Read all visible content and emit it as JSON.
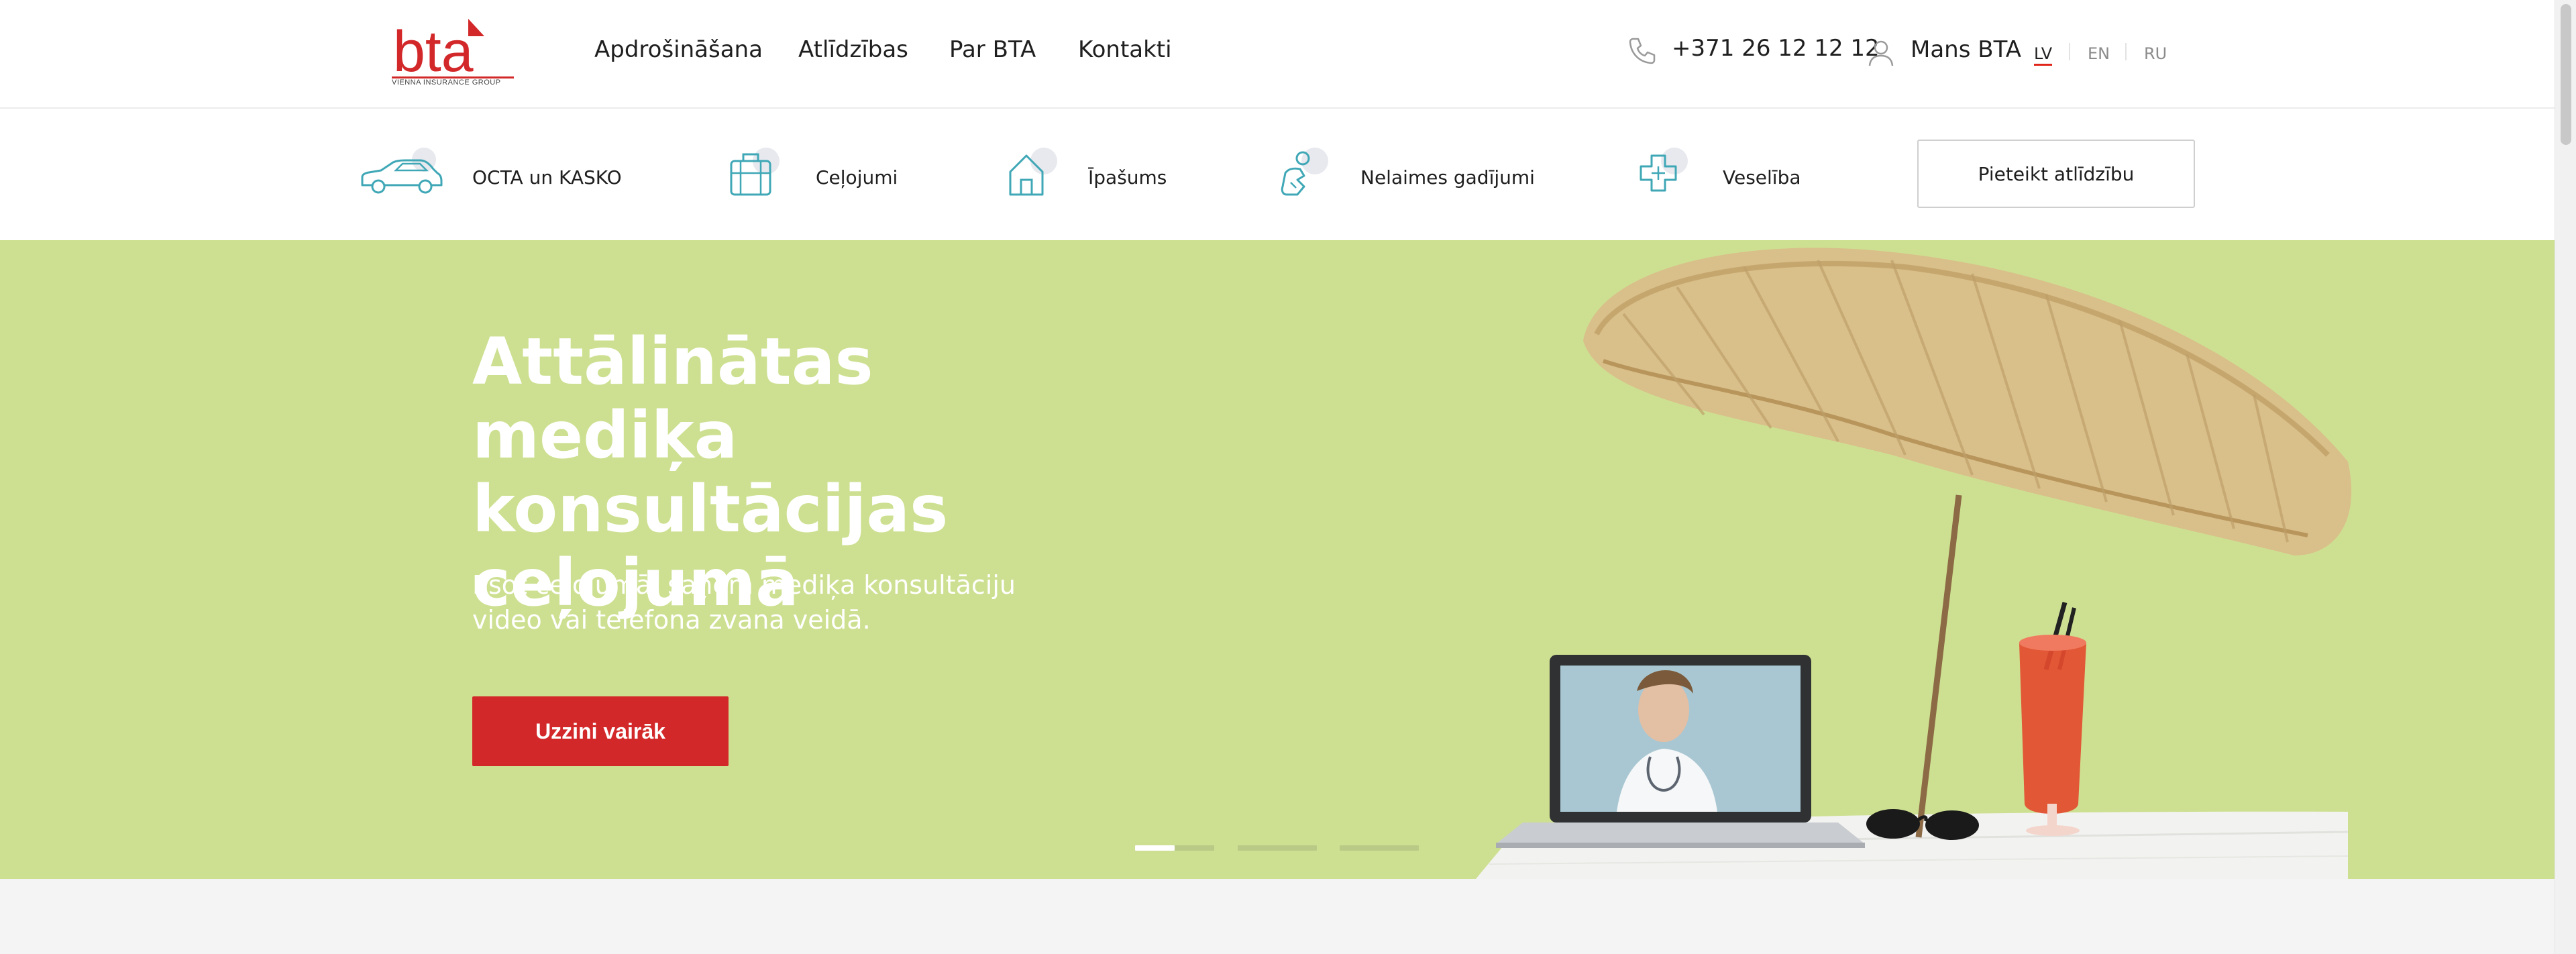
{
  "header": {
    "logo_text": "bta",
    "logo_tagline": "VIENNA INSURANCE GROUP",
    "nav": [
      {
        "label": "Apdrošināšana"
      },
      {
        "label": "Atlīdzības"
      },
      {
        "label": "Par BTA"
      },
      {
        "label": "Kontakti"
      }
    ],
    "phone": "+371 26 12 12 12",
    "account_label": "Mans BTA",
    "languages": [
      {
        "code": "LV",
        "active": true
      },
      {
        "code": "EN",
        "active": false
      },
      {
        "code": "RU",
        "active": false
      }
    ]
  },
  "categories": [
    {
      "label": "OCTA un KASKO",
      "icon": "car-icon"
    },
    {
      "label": "Ceļojumi",
      "icon": "suitcase-icon"
    },
    {
      "label": "Īpašums",
      "icon": "house-icon"
    },
    {
      "label": "Nelaimes gadījumi",
      "icon": "injury-icon"
    },
    {
      "label": "Veselība",
      "icon": "medical-cross-icon"
    }
  ],
  "claim_button": "Pieteikt atlīdzību",
  "hero": {
    "title_lines": [
      "Attālinātas mediķa",
      "konsultācijas",
      "ceļojumā"
    ],
    "subtitle": "Esot ceļojumā, saņem mediķa konsultāciju video vai telefona zvana veidā.",
    "cta": "Uzzini vairāk",
    "slides": [
      {
        "progress": 0.5
      },
      {
        "progress": 0
      },
      {
        "progress": 0
      }
    ]
  },
  "colors": {
    "brand_red": "#d3282a",
    "hero_bg": "#cde091",
    "icon_teal": "#3fa7b6"
  }
}
